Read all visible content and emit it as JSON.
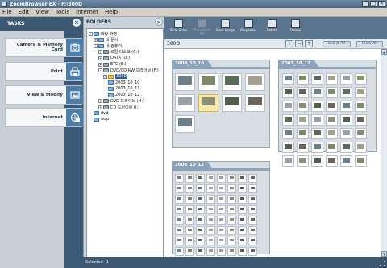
{
  "window": {
    "title": "ZoomBrowser EX - F:\\300D"
  },
  "menu": [
    "File",
    "Edit",
    "View",
    "Tools",
    "Internet",
    "Help"
  ],
  "tasks": {
    "header": "TASKS",
    "items": [
      {
        "label": "Camera & Memory Card",
        "icon": "camera-icon"
      },
      {
        "label": "Print",
        "icon": "printer-icon"
      },
      {
        "label": "View & Modify",
        "icon": "image-edit-icon"
      },
      {
        "label": "Internet",
        "icon": "globe-mail-icon"
      }
    ]
  },
  "folders": {
    "header": "FOLDERS",
    "tree": [
      {
        "label": "바탕 화면",
        "depth": 0,
        "exp": "-",
        "kind": "folder"
      },
      {
        "label": "내 문서",
        "depth": 1,
        "exp": "+",
        "kind": "folder"
      },
      {
        "label": "내 컴퓨터",
        "depth": 1,
        "exp": "-",
        "kind": "folder"
      },
      {
        "label": "로컬 디스크 (C:)",
        "depth": 2,
        "exp": "+",
        "kind": "drive"
      },
      {
        "label": "DATA (D:)",
        "depth": 2,
        "exp": "+",
        "kind": "drive"
      },
      {
        "label": "ETC (E:)",
        "depth": 2,
        "exp": "+",
        "kind": "drive"
      },
      {
        "label": "DVD/CD-RW 드라이브 (F:)",
        "depth": 2,
        "exp": "-",
        "kind": "drive"
      },
      {
        "label": "300D",
        "depth": 3,
        "exp": "-",
        "kind": "yellow",
        "selected": true
      },
      {
        "label": "2003_10_10",
        "depth": 4,
        "exp": "",
        "kind": "folder"
      },
      {
        "label": "2003_10_11",
        "depth": 4,
        "exp": "",
        "kind": "folder"
      },
      {
        "label": "2003_10_12",
        "depth": 4,
        "exp": "",
        "kind": "folder"
      },
      {
        "label": "DVD 드라이브 (H:)",
        "depth": 2,
        "exp": "+",
        "kind": "drive"
      },
      {
        "label": "CD 드라이브 (I:)",
        "depth": 2,
        "exp": "+",
        "kind": "drive"
      },
      {
        "label": "dvd",
        "depth": 1,
        "exp": "",
        "kind": "folder"
      },
      {
        "label": "wap",
        "depth": 1,
        "exp": "",
        "kind": "folder"
      }
    ]
  },
  "toolbar": {
    "buttons": [
      {
        "label": "Slide Show",
        "enabled": true
      },
      {
        "label": "Thumbnail list",
        "enabled": false
      },
      {
        "label": "View Image",
        "enabled": true
      },
      {
        "label": "Properties",
        "enabled": true
      },
      {
        "label": "Rotate",
        "enabled": true
      },
      {
        "label": "Delete",
        "enabled": true
      }
    ]
  },
  "subbar": {
    "path": "300D",
    "select_all": "Select All",
    "clear_all": "Clear All"
  },
  "groups": [
    {
      "title": "2003_10_10",
      "count": 9
    },
    {
      "title": "2003_10_11",
      "count": 42
    },
    {
      "title": "2003_10_12",
      "count": 64
    }
  ],
  "status": {
    "label": "Selected",
    "count": "1"
  },
  "colors": {
    "accent": "#3d5873",
    "highlight": "#f8e9a8"
  }
}
